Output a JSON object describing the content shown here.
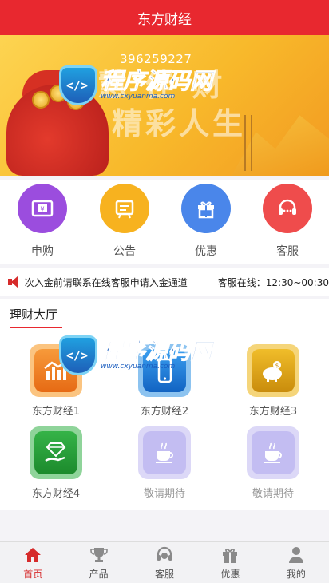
{
  "header": {
    "title": "东方财经"
  },
  "banner": {
    "qq": "396259227",
    "slogan_line1": "智慧 佳 财",
    "slogan_line2": "精彩人生"
  },
  "watermark": {
    "title": "程序源码网",
    "url": "www.cxyuanma.com"
  },
  "quick_links": [
    {
      "label": "申购",
      "icon": "atm-card-icon",
      "color": "#9b4dde"
    },
    {
      "label": "公告",
      "icon": "notice-board-icon",
      "color": "#f7b21f"
    },
    {
      "label": "优惠",
      "icon": "gift-icon",
      "color": "#4a86ea"
    },
    {
      "label": "客服",
      "icon": "headset-icon",
      "color": "#ef4c4c"
    }
  ],
  "notice": {
    "message": "次入金前请联系在线客服申请入金通道",
    "service_time": "客服在线：12:30~00:30"
  },
  "hall": {
    "title": "理财大厅",
    "products": [
      {
        "label": "东方财经1",
        "icon": "bar-chart-icon",
        "color": "#f07a1f"
      },
      {
        "label": "东方财经2",
        "icon": "phone-icon",
        "color": "#1e7fd6"
      },
      {
        "label": "东方财经3",
        "icon": "piggy-bank-icon",
        "color": "#e1a516"
      },
      {
        "label": "东方财经4",
        "icon": "diamond-hand-icon",
        "color": "#2e9e3c"
      },
      {
        "label": "敬请期待",
        "icon": "coffee-cup-icon",
        "color": "#b9b2ee"
      },
      {
        "label": "敬请期待",
        "icon": "coffee-cup-icon",
        "color": "#b9b2ee"
      }
    ]
  },
  "tabbar": [
    {
      "label": "首页",
      "icon": "home-icon",
      "active": true
    },
    {
      "label": "产品",
      "icon": "trophy-icon",
      "active": false
    },
    {
      "label": "客服",
      "icon": "headset-icon",
      "active": false
    },
    {
      "label": "优惠",
      "icon": "gift-icon",
      "active": false
    },
    {
      "label": "我的",
      "icon": "user-icon",
      "active": false
    }
  ],
  "colors": {
    "brand": "#e8282f",
    "tab_active": "#d62b2b"
  }
}
